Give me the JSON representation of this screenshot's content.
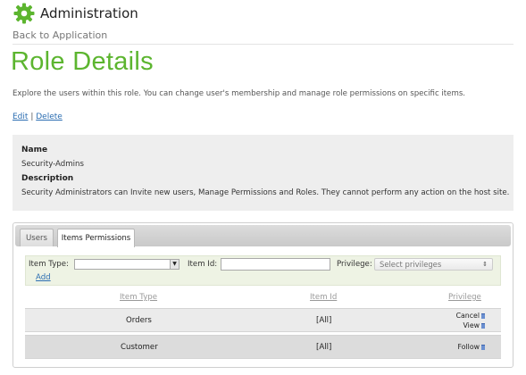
{
  "header": {
    "title": "Administration",
    "icon": "gear-icon",
    "accent": "#5cb52f"
  },
  "nav": {
    "back_label": "Back to Application"
  },
  "page": {
    "title": "Role Details",
    "intro": "Explore the users within this role. You can change user's membership and manage role permissions on specific items."
  },
  "actions": {
    "edit": "Edit",
    "separator": "|",
    "delete": "Delete"
  },
  "role": {
    "name_label": "Name",
    "name_value": "Security-Admins",
    "description_label": "Description",
    "description_value": "Security Administrators can Invite new users, Manage Permissions and Roles. They cannot perform any action on the host site."
  },
  "tabs": [
    {
      "label": "Users",
      "active": false
    },
    {
      "label": "Items Permissions",
      "active": true
    }
  ],
  "filter": {
    "item_type_label": "Item Type:",
    "item_type_value": "",
    "item_id_label": "Item Id:",
    "item_id_value": "",
    "privilege_label": "Privilege:",
    "privilege_placeholder": "Select privileges",
    "add_label": "Add"
  },
  "table": {
    "columns": [
      "Item Type",
      "Item Id",
      "Privilege"
    ],
    "rows": [
      {
        "item_type": "Orders",
        "item_id": "[All]",
        "privileges": [
          "Cancel",
          "View"
        ]
      },
      {
        "item_type": "Customer",
        "item_id": "[All]",
        "privileges": [
          "Follow"
        ]
      }
    ]
  }
}
